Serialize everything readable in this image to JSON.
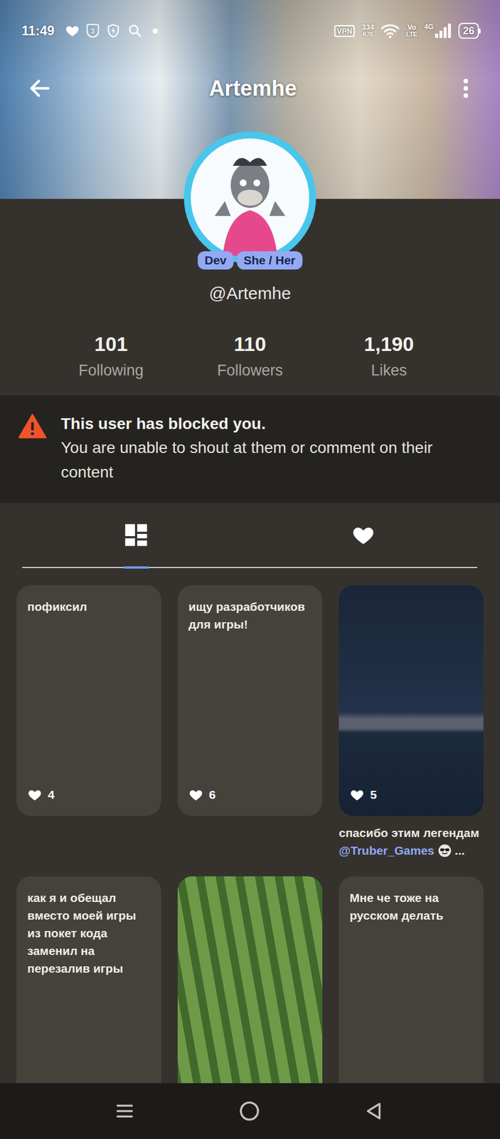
{
  "status_bar": {
    "time": "11:49",
    "notification_count": "3",
    "vpn": "VPN",
    "speed_value": "334",
    "speed_unit": "K/S",
    "volte_top": "Vo",
    "volte_bottom": "LTE",
    "network": "4G",
    "battery": "26"
  },
  "header": {
    "title": "Artemhe"
  },
  "profile": {
    "badges": [
      "Dev",
      "She / Her"
    ],
    "handle": "@Artemhe",
    "stats": [
      {
        "value": "101",
        "label": "Following"
      },
      {
        "value": "110",
        "label": "Followers"
      },
      {
        "value": "1,190",
        "label": "Likes"
      }
    ]
  },
  "notice": {
    "title": "This user has blocked you.",
    "message": "You are unable to shout at them or comment on their content"
  },
  "tabs": [
    {
      "kind": "grid",
      "selected": true
    },
    {
      "kind": "heart",
      "selected": false
    }
  ],
  "posts": [
    {
      "kind": "text",
      "text": "пофиксил",
      "likes": "4"
    },
    {
      "kind": "text",
      "text": "ищу разработчиков для игры!",
      "likes": "6"
    },
    {
      "kind": "image",
      "likes": "5",
      "caption": "спасибо этим легендам",
      "mention": "@Truber_Games",
      "more": "..."
    },
    {
      "kind": "text",
      "text": "как я и обещал вместо моей игры из покет кода заменил на перезалив игры"
    },
    {
      "kind": "image"
    },
    {
      "kind": "text",
      "text": "Мне че тоже на русском делать"
    }
  ]
}
